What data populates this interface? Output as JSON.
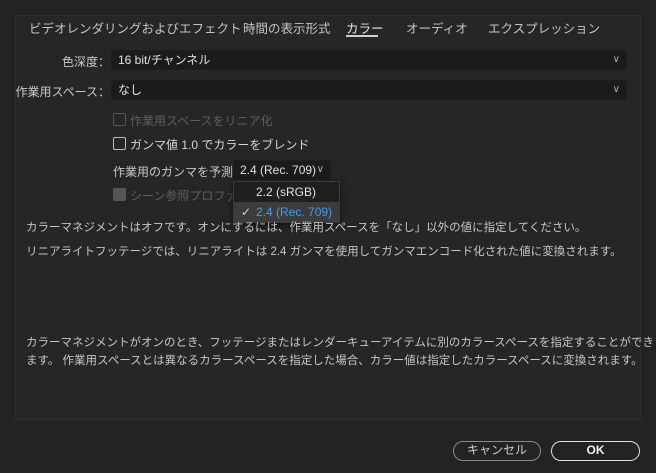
{
  "tabs": [
    "ビデオレンダリングおよびエフェクト",
    "時間の表示形式",
    "カラー",
    "オーディオ",
    "エクスプレッション"
  ],
  "active_tab": "カラー",
  "color_depth": {
    "label": "色深度：",
    "value": "16 bit/チャンネル"
  },
  "working_space": {
    "label": "作業用スペース：",
    "value": "なし"
  },
  "linearize": {
    "label": "作業用スペースをリニア化",
    "checked": false,
    "disabled": true
  },
  "blend": {
    "label": "ガンマ値 1.0 でカラーをブレンド",
    "checked": false
  },
  "gamma": {
    "label": "作業用のガンマを予測：",
    "value": "2.4 (Rec. 709)",
    "options": [
      "2.2 (sRGB)",
      "2.4 (Rec. 709)"
    ],
    "check": "✓"
  },
  "scene": {
    "label": "シーン参照プロファイル",
    "checked": true,
    "disabled": true
  },
  "info": [
    "カラーマネジメントはオフです。オンにするには、作業用スペースを「なし」以外の値に指定してください。",
    "リニアライトフッテージでは、リニアライトは 2.4 ガンマを使用してガンマエンコード化された値に変換されます。",
    "カラーマネジメントがオンのとき、フッテージまたはレンダーキューアイテムに別のカラースペースを指定することができ",
    "ます。 作業用スペースとは異なるカラースペースを指定した場合、カラー値は指定したカラースペースに変換されます。"
  ],
  "buttons": {
    "cancel": "キャンセル",
    "ok": "OK"
  },
  "colors": {
    "accent": "#3aa0ef"
  }
}
